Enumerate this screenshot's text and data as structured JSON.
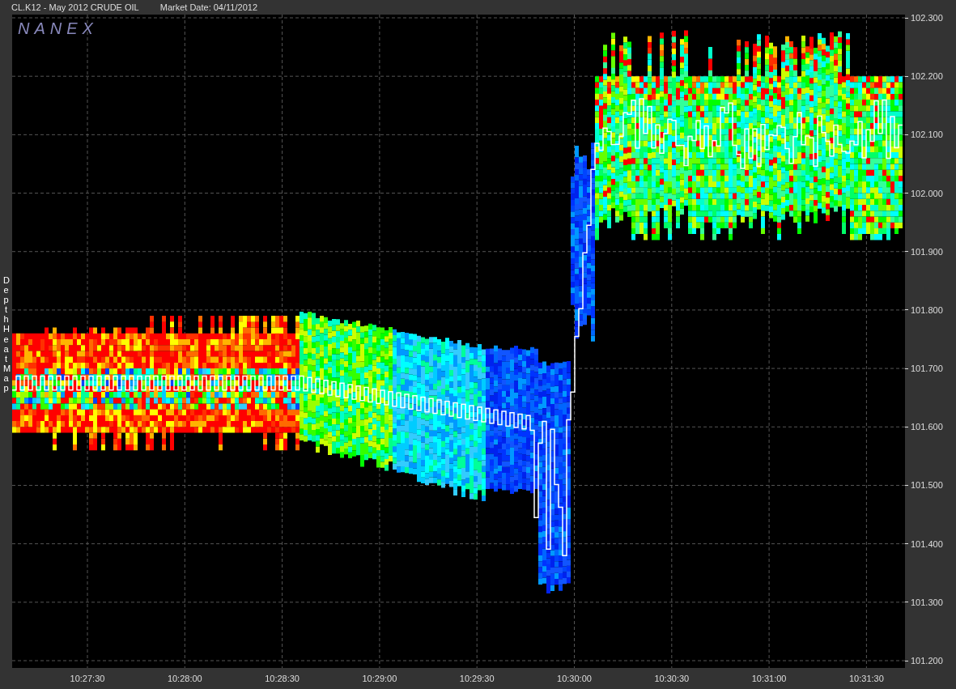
{
  "header": {
    "symbol": "CL.K12 - May 2012 CRUDE OIL",
    "market_date": "Market Date: 04/11/2012"
  },
  "side_label": "Depth Heat Map",
  "chart": {
    "logo": "NANEX",
    "y_ticks": [
      "102.300",
      "102.200",
      "102.100",
      "102.000",
      "101.900",
      "101.800",
      "101.700",
      "101.600",
      "101.500",
      "101.400",
      "101.300",
      "101.200"
    ],
    "x_ticks": [
      "10:27:30",
      "10:28:00",
      "10:28:30",
      "10:29:00",
      "10:29:30",
      "10:30:00",
      "10:30:30",
      "10:31:00",
      "10:31:30"
    ]
  }
}
